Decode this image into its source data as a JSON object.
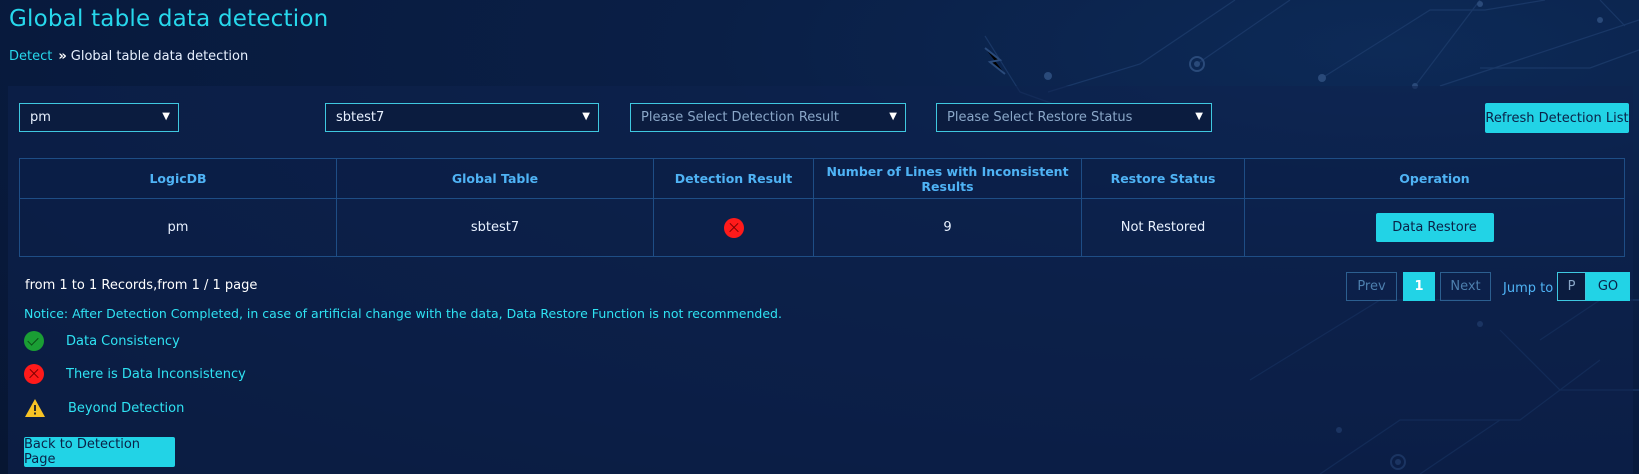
{
  "header": {
    "title": "Global table data detection",
    "breadcrumb": {
      "link": "Detect",
      "separator": "»",
      "current": "Global table data detection"
    }
  },
  "filters": {
    "logic_db": "pm",
    "table": "sbtest7",
    "detection_result_placeholder": "Please Select Detection Result",
    "restore_status_placeholder": "Please Select Restore Status",
    "refresh_label": "Refresh Detection List"
  },
  "table": {
    "columns": [
      "LogicDB",
      "Global Table",
      "Detection Result",
      "Number of Lines with Inconsistent Results",
      "Restore Status",
      "Operation"
    ],
    "rows": [
      {
        "logic_db": "pm",
        "global_table": "sbtest7",
        "detection_result_icon": "inconsistent-icon",
        "inconsistent_lines": "9",
        "restore_status": "Not Restored",
        "operation_label": "Data Restore"
      }
    ]
  },
  "pagination": {
    "records_text": "from 1 to 1 Records,from 1 / 1 page",
    "prev": "Prev",
    "current_page": "1",
    "next": "Next",
    "jump_label": "Jump to",
    "jump_placeholder": "P",
    "go": "GO"
  },
  "notice": "Notice: After Detection Completed, in case of artificial change with the data, Data Restore Function is not recommended.",
  "legend": [
    {
      "icon": "check-circle-icon",
      "label": "Data Consistency"
    },
    {
      "icon": "x-circle-icon",
      "label": "There is Data Inconsistency"
    },
    {
      "icon": "warning-triangle-icon",
      "label": "Beyond Detection"
    }
  ],
  "back_label": "Back to Detection Page",
  "colors": {
    "accent": "#22d3e6",
    "error": "#ff1a1a",
    "success": "#1a9e34",
    "warning": "#f7c325",
    "background": "#0a1f46"
  }
}
